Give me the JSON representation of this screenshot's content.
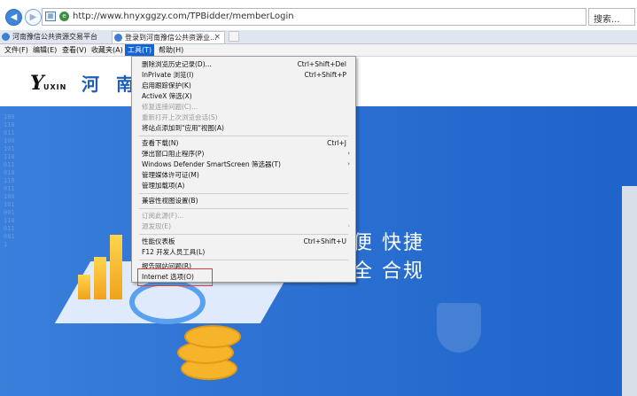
{
  "browser": {
    "url": "http://www.hnyxggzy.com/TPBidder/memberLogin",
    "url_domain": "hnyxggzy.com",
    "search_placeholder": "搜索...",
    "tabs": [
      {
        "label": "河南豫信公共资源交易平台"
      },
      {
        "label": "登录到河南豫信公共资源业...",
        "close": "×"
      }
    ],
    "menu": [
      "文件(F)",
      "编辑(E)",
      "查看(V)",
      "收藏夹(A)",
      "工具(T)",
      "帮助(H)"
    ],
    "active_menu": "工具(T)"
  },
  "site": {
    "logo_mark": "Y",
    "logo_text": "UXIN",
    "title_visible": "河 南 "
  },
  "hero": {
    "slogan_line1": "便 快捷",
    "slogan_line2": "全 合规"
  },
  "tools_menu": [
    {
      "label": "删除浏览历史记录(D)...",
      "shortcut": "Ctrl+Shift+Del"
    },
    {
      "label": "InPrivate 浏览(I)",
      "shortcut": "Ctrl+Shift+P"
    },
    {
      "label": "启用跟踪保护(K)"
    },
    {
      "label": "ActiveX 筛选(X)"
    },
    {
      "label": "修复连接问题(C)...",
      "disabled": true
    },
    {
      "label": "重新打开上次浏览会话(S)",
      "disabled": true
    },
    {
      "label": "将站点添加到\"应用\"视图(A)"
    },
    {
      "label": "查看下载(N)",
      "shortcut": "Ctrl+J"
    },
    {
      "label": "弹出窗口阻止程序(P)",
      "submenu": true
    },
    {
      "label": "Windows Defender SmartScreen 筛选器(T)",
      "submenu": true
    },
    {
      "label": "管理媒体许可证(M)"
    },
    {
      "label": "管理加载项(A)"
    },
    {
      "label": "兼容性视图设置(B)"
    },
    {
      "label": "订阅此源(F)...",
      "disabled": true
    },
    {
      "label": "源发现(E)",
      "disabled": true,
      "submenu": true
    },
    {
      "label": "性能仪表板",
      "shortcut": "Ctrl+Shift+U"
    },
    {
      "label": "F12 开发人员工具(L)"
    },
    {
      "label": "报告网站问题(R)"
    },
    {
      "label": "Internet 选项(O)",
      "highlighted": true
    }
  ],
  "colors": {
    "hero_blue": "#1d63c9",
    "menu_active": "#1464d2",
    "highlight_box": "#e03a3a",
    "site_title": "#1d5fb8"
  }
}
